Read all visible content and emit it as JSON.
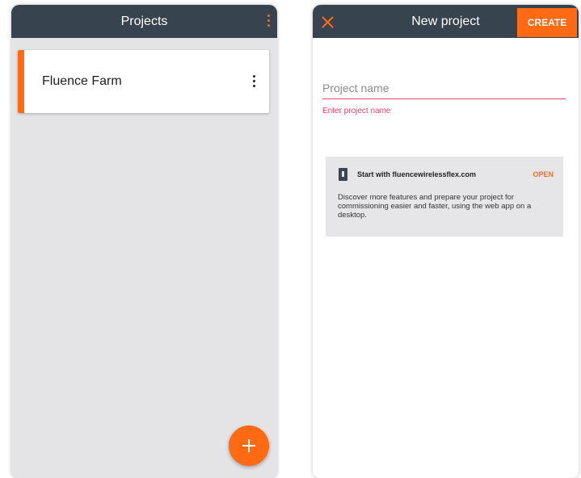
{
  "colors": {
    "appbar": "#37444f",
    "accent": "#ff6a13",
    "error": "#f2456a",
    "panel_bg": "#e4e4e6",
    "banner_bg": "#e6e6e8"
  },
  "projects_screen": {
    "title": "Projects",
    "overflow_icon": "more-vertical-icon",
    "projects": [
      {
        "name": "Fluence Farm",
        "menu_icon": "more-vertical-icon"
      }
    ],
    "fab_icon": "plus-icon"
  },
  "new_project_screen": {
    "title": "New project",
    "close_icon": "close-icon",
    "create_label": "CREATE",
    "name_field": {
      "placeholder": "Project name",
      "value": "",
      "error": "Enter project name"
    },
    "web_banner": {
      "icon": "phone-icon",
      "title": "Start with fluencewirelessflex.com",
      "open_label": "OPEN",
      "body": "Discover more features and prepare your project for commissioning easier and faster, using the web app on a desktop."
    }
  }
}
